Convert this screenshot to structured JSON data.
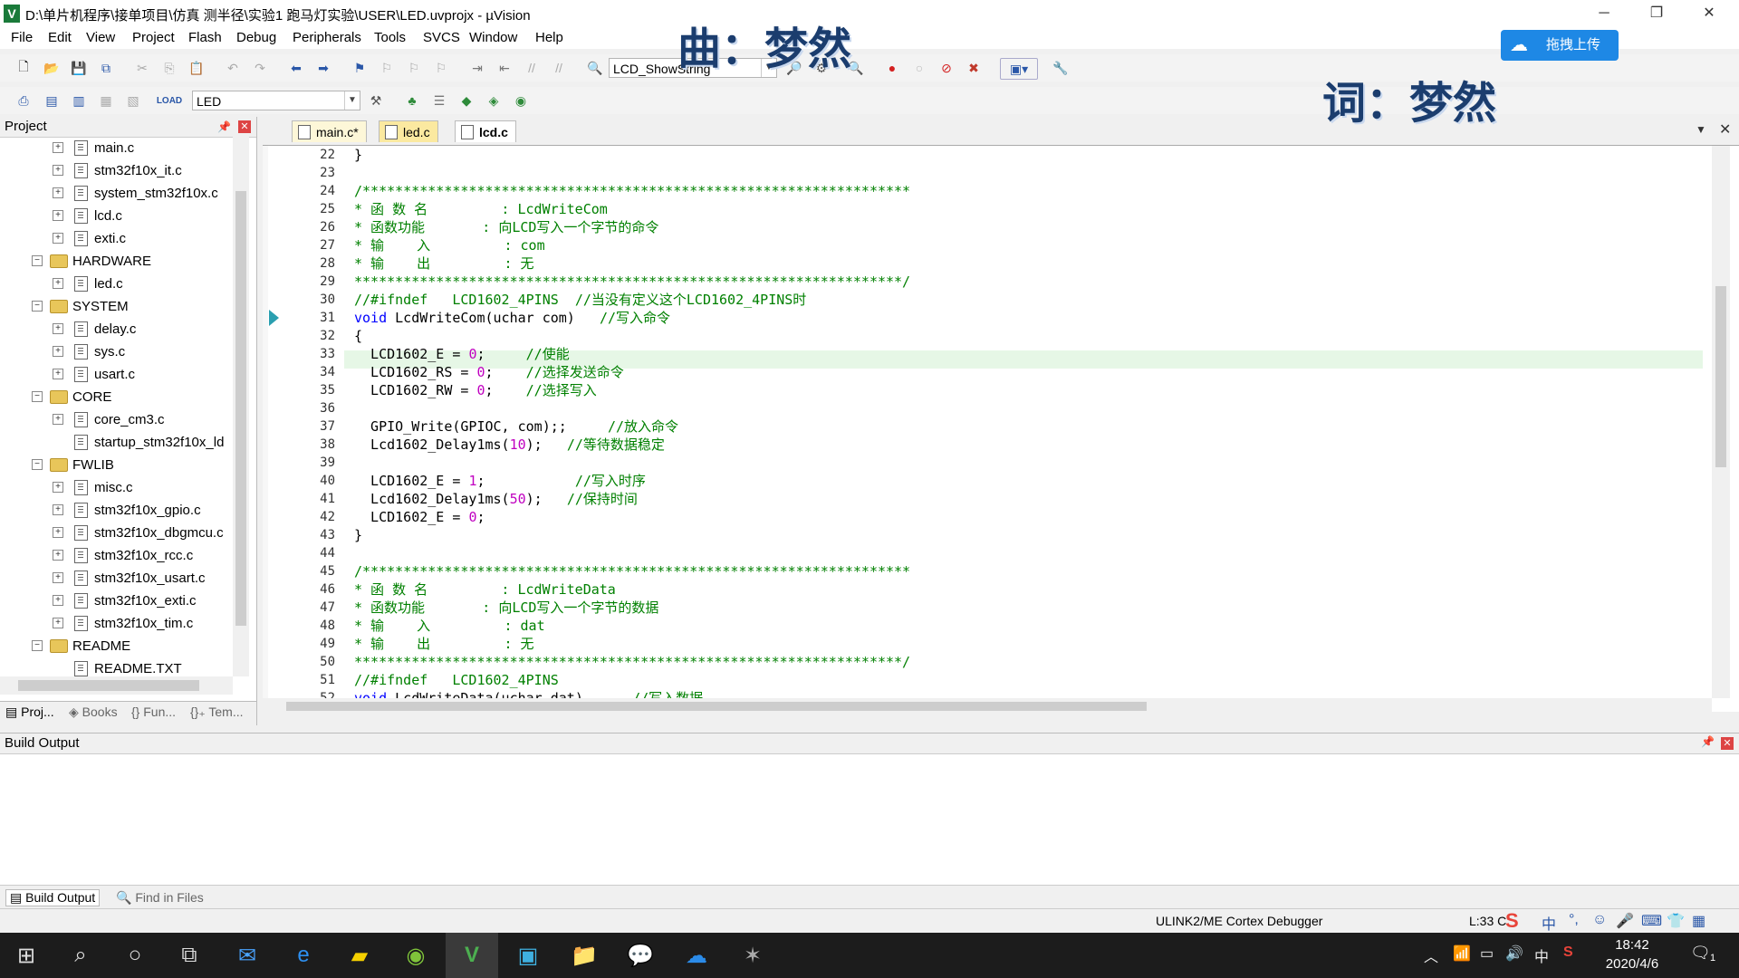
{
  "window": {
    "title": "D:\\单片机程序\\接单项目\\仿真 测半径\\实验1 跑马灯实验\\USER\\LED.uvprojx - µVision",
    "app_icon_letter": "V"
  },
  "menu": [
    "File",
    "Edit",
    "View",
    "Project",
    "Flash",
    "Debug",
    "Peripherals",
    "Tools",
    "SVCS",
    "Window",
    "Help"
  ],
  "toolbar": {
    "find_combo_value": "LCD_ShowString",
    "target_combo_value": "LED"
  },
  "overlays": {
    "song_label": "曲：",
    "song_value": "梦然",
    "lyric_label": "词：",
    "lyric_value": "梦然",
    "upload_button": "拖拽上传"
  },
  "project_panel": {
    "title": "Project",
    "items": [
      {
        "label": "main.c",
        "kind": "file"
      },
      {
        "label": "stm32f10x_it.c",
        "kind": "file"
      },
      {
        "label": "system_stm32f10x.c",
        "kind": "file"
      },
      {
        "label": "lcd.c",
        "kind": "file"
      },
      {
        "label": "exti.c",
        "kind": "file"
      },
      {
        "label": "HARDWARE",
        "kind": "group"
      },
      {
        "label": "led.c",
        "kind": "file"
      },
      {
        "label": "SYSTEM",
        "kind": "group"
      },
      {
        "label": "delay.c",
        "kind": "file"
      },
      {
        "label": "sys.c",
        "kind": "file"
      },
      {
        "label": "usart.c",
        "kind": "file"
      },
      {
        "label": "CORE",
        "kind": "group"
      },
      {
        "label": "core_cm3.c",
        "kind": "file"
      },
      {
        "label": "startup_stm32f10x_ld",
        "kind": "file"
      },
      {
        "label": "FWLIB",
        "kind": "group"
      },
      {
        "label": "misc.c",
        "kind": "file"
      },
      {
        "label": "stm32f10x_gpio.c",
        "kind": "file"
      },
      {
        "label": "stm32f10x_dbgmcu.c",
        "kind": "file"
      },
      {
        "label": "stm32f10x_rcc.c",
        "kind": "file"
      },
      {
        "label": "stm32f10x_usart.c",
        "kind": "file"
      },
      {
        "label": "stm32f10x_exti.c",
        "kind": "file"
      },
      {
        "label": "stm32f10x_tim.c",
        "kind": "file"
      },
      {
        "label": "README",
        "kind": "group"
      },
      {
        "label": "README.TXT",
        "kind": "file"
      }
    ],
    "bottom_tabs": [
      "Proj...",
      "Books",
      "{} Fun...",
      "{}₊ Tem..."
    ]
  },
  "editor": {
    "tabs": [
      {
        "label": "main.c*",
        "active": false
      },
      {
        "label": "led.c",
        "active": false
      },
      {
        "label": "lcd.c",
        "active": true
      }
    ],
    "lines": [
      {
        "n": "22",
        "text": "}",
        "type": "normal"
      },
      {
        "n": "23",
        "text": "",
        "type": "normal"
      },
      {
        "n": "24",
        "text": "/*******************************************************************",
        "type": "stars"
      },
      {
        "n": "25",
        "text": "* 函 数 名         : LcdWriteCom",
        "type": "comment"
      },
      {
        "n": "26",
        "text": "* 函数功能       : 向LCD写入一个字节的命令",
        "type": "comment"
      },
      {
        "n": "27",
        "text": "* 输    入         : com",
        "type": "comment"
      },
      {
        "n": "28",
        "text": "* 输    出         : 无",
        "type": "comment"
      },
      {
        "n": "29",
        "text": "*******************************************************************/",
        "type": "stars"
      },
      {
        "n": "30",
        "text": "//#ifndef   LCD1602_4PINS  //当没有定义这个LCD1602_4PINS时",
        "type": "comment"
      },
      {
        "n": "31",
        "text": "void LcdWriteCom(uchar com)   //写入命令",
        "type": "func"
      },
      {
        "n": "32",
        "text": "{",
        "type": "normal"
      },
      {
        "n": "33",
        "text": "  LCD1602_E = 0;     //使能",
        "type": "stmt"
      },
      {
        "n": "34",
        "text": "  LCD1602_RS = 0;    //选择发送命令",
        "type": "stmt"
      },
      {
        "n": "35",
        "text": "  LCD1602_RW = 0;    //选择写入",
        "type": "stmt"
      },
      {
        "n": "36",
        "text": "",
        "type": "normal"
      },
      {
        "n": "37",
        "text": "  GPIO_Write(GPIOC, com);;     //放入命令",
        "type": "stmt"
      },
      {
        "n": "38",
        "text": "  Lcd1602_Delay1ms(10);   //等待数据稳定",
        "type": "stmt"
      },
      {
        "n": "39",
        "text": "",
        "type": "normal"
      },
      {
        "n": "40",
        "text": "  LCD1602_E = 1;           //写入时序",
        "type": "stmt"
      },
      {
        "n": "41",
        "text": "  Lcd1602_Delay1ms(50);   //保持时间",
        "type": "stmt"
      },
      {
        "n": "42",
        "text": "  LCD1602_E = 0;",
        "type": "stmt"
      },
      {
        "n": "43",
        "text": "}",
        "type": "normal"
      },
      {
        "n": "44",
        "text": "",
        "type": "normal"
      },
      {
        "n": "45",
        "text": "/*******************************************************************",
        "type": "stars"
      },
      {
        "n": "46",
        "text": "* 函 数 名         : LcdWriteData",
        "type": "comment"
      },
      {
        "n": "47",
        "text": "* 函数功能       : 向LCD写入一个字节的数据",
        "type": "comment"
      },
      {
        "n": "48",
        "text": "* 输    入         : dat",
        "type": "comment"
      },
      {
        "n": "49",
        "text": "* 输    出         : 无",
        "type": "comment"
      },
      {
        "n": "50",
        "text": "*******************************************************************/",
        "type": "stars"
      },
      {
        "n": "51",
        "text": "//#ifndef   LCD1602_4PINS",
        "type": "comment"
      },
      {
        "n": "52",
        "text": "void LcdWriteData(uchar dat)      //写入数据",
        "type": "func"
      }
    ]
  },
  "build_output": {
    "title": "Build Output",
    "tabs": [
      "Build Output",
      "Find in Files"
    ]
  },
  "status": {
    "debugger": "ULINK2/ME Cortex Debugger",
    "cursor": "L:33 C:"
  },
  "taskbar": {
    "time": "18:42",
    "date": "2020/4/6",
    "ime": "中",
    "notification_count": "1"
  }
}
